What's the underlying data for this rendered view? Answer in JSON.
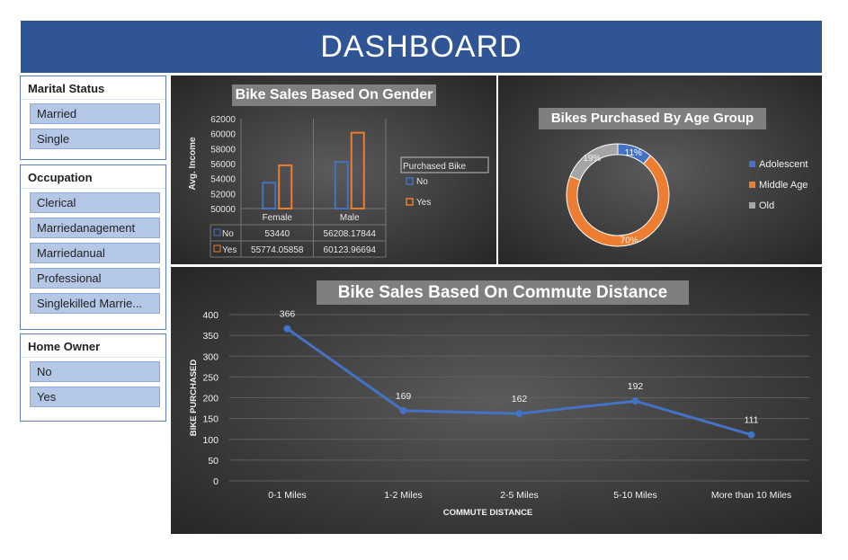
{
  "dashboard": {
    "title": "DASHBOARD"
  },
  "slicers": {
    "marital": {
      "title": "Marital Status",
      "items": [
        "Married",
        "Single"
      ]
    },
    "occupation": {
      "title": "Occupation",
      "items": [
        "Clerical",
        "Marriedanagement",
        "Marriedanual",
        "Professional",
        "Singlekilled Marrie..."
      ]
    },
    "home_owner": {
      "title": "Home Owner",
      "items": [
        "No",
        "Yes"
      ]
    }
  },
  "colors": {
    "header": "#2f5597",
    "no": "#4472c4",
    "yes": "#ed7d31",
    "old": "#a5a5a5",
    "line": "#4472c4",
    "slicer": "#b4c7e7"
  },
  "chart_data": [
    {
      "type": "bar",
      "title": "Bike Sales Based On Gender",
      "ylabel": "Avg. Income",
      "categories": [
        "Female",
        "Male"
      ],
      "ylim": [
        50000,
        62000
      ],
      "yticks": [
        "62000",
        "60000",
        "58000",
        "56000",
        "54000",
        "52000",
        "50000"
      ],
      "legend_title": "Purchased Bike",
      "series": [
        {
          "name": "No",
          "values": [
            53440,
            56208.17844
          ],
          "labels": [
            "53440",
            "56208.17844"
          ]
        },
        {
          "name": "Yes",
          "values": [
            55774.05858,
            60123.96694
          ],
          "labels": [
            "55774.05858",
            "60123.96694"
          ]
        }
      ]
    },
    {
      "type": "pie",
      "title": "Bikes Purchased By Age Group",
      "labels": [
        "Adolescent",
        "Middle Age",
        "Old"
      ],
      "values": [
        11,
        70,
        19
      ],
      "value_labels": [
        "11%",
        "70%",
        "19%"
      ],
      "legend": "right"
    },
    {
      "type": "line",
      "title": "Bike Sales Based On Commute Distance",
      "xlabel": "COMMUTE DISTANCE",
      "ylabel": "BIKE PURCHASED",
      "categories": [
        "0-1 Miles",
        "1-2 Miles",
        "2-5 Miles",
        "5-10 Miles",
        "More than 10 Miles"
      ],
      "values": [
        366,
        169,
        162,
        192,
        111
      ],
      "ylim": [
        0,
        400
      ],
      "yticks": [
        "400",
        "350",
        "300",
        "250",
        "200",
        "150",
        "100",
        "50",
        "0"
      ],
      "grid": true
    }
  ]
}
